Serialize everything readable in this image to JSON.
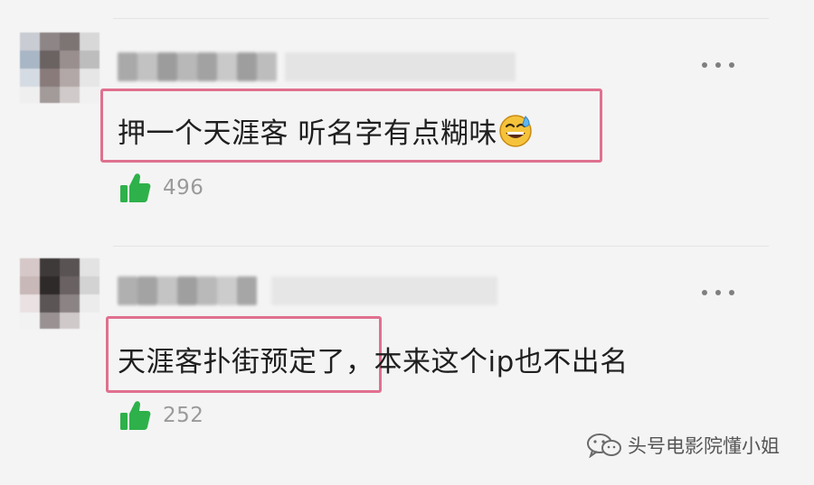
{
  "comments": [
    {
      "text": "押一个天涯客 听名字有点糊味",
      "emoji": "sweat-smile-emoji",
      "likes": "496"
    },
    {
      "highlight_text": "天涯客扑街预定了",
      "rest_text": "，本来这个ip也不出名",
      "likes": "252"
    }
  ],
  "watermark": {
    "text": "头号电影院懂小姐",
    "icon": "wechat-icon"
  },
  "colors": {
    "highlight_border": "#e0708e",
    "like_icon": "#2eb14a",
    "like_count": "#9a9a9a",
    "background": "#f4f4f4"
  }
}
